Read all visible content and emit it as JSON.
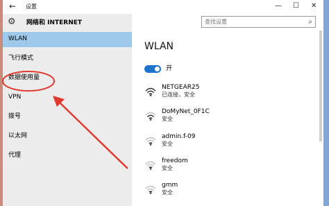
{
  "window": {
    "title": "设置",
    "back_icon": "back-arrow-icon",
    "minimize_glyph": "—",
    "maximize_glyph": "☐",
    "close_glyph": "✕"
  },
  "sidebar": {
    "heading": "网络和 INTERNET",
    "heading_icon": "gear-icon",
    "items": [
      {
        "label": "WLAN",
        "active": true
      },
      {
        "label": "飞行模式",
        "active": false
      },
      {
        "label": "数据使用量",
        "active": false
      },
      {
        "label": "VPN",
        "active": false
      },
      {
        "label": "拨号",
        "active": false
      },
      {
        "label": "以太网",
        "active": false
      },
      {
        "label": "代理",
        "active": false
      }
    ]
  },
  "search": {
    "placeholder": "查找设置",
    "icon": "search-icon"
  },
  "main": {
    "title": "WLAN",
    "toggle": {
      "state": "on",
      "label": "开"
    },
    "networks": [
      {
        "ssid": "NETGEAR25",
        "status": "已连接，安全",
        "icon": "wifi-icon"
      },
      {
        "ssid": "DoMyNet_0F1C",
        "status": "安全",
        "icon": "wifi-icon"
      },
      {
        "ssid": "admin.f-09",
        "status": "安全",
        "icon": "wifi-icon"
      },
      {
        "ssid": "freedom",
        "status": "安全",
        "icon": "wifi-icon"
      },
      {
        "ssid": "gmm",
        "status": "安全",
        "icon": "wifi-icon"
      }
    ]
  },
  "annotation": {
    "color": "#e03a2f",
    "target": "数据使用量"
  },
  "colors": {
    "accent": "#1e74c9",
    "sidebar_bg": "#ececec",
    "active_item_bg": "#9ec9ea"
  }
}
